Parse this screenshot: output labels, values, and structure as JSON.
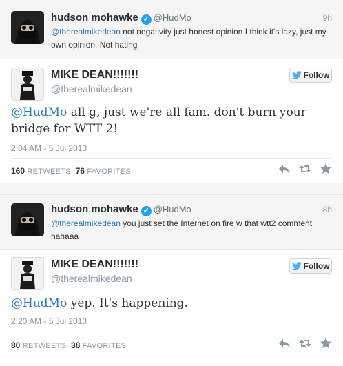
{
  "reply1": {
    "name": "hudson mohawke",
    "handle": "@HudMo",
    "time": "9h",
    "mention": "@therealmikedean",
    "text": " not negativity just honest opinion I think it's lazy, just my own opinion. Not hating"
  },
  "tweet1": {
    "name": "MIKE DEAN!!!!!!!",
    "handle": "@therealmikedean",
    "follow_label": "Follow",
    "mention": "@HudMo",
    "text": " all g,  just we're all fam. don't burn your bridge for WTT 2!",
    "date": "2:04 AM - 5 Jul 2013",
    "retweets_count": "160",
    "retweets_label": "RETWEETS",
    "favorites_count": "76",
    "favorites_label": "FAVORITES"
  },
  "reply2": {
    "name": "hudson mohawke",
    "handle": "@HudMo",
    "time": "8h",
    "mention": "@therealmikedean",
    "text": " you just set the Internet on fire w that wtt2 comment hahaaa"
  },
  "tweet2": {
    "name": "MIKE DEAN!!!!!!!",
    "handle": "@therealmikedean",
    "follow_label": "Follow",
    "mention": "@HudMo",
    "text": "  yep. It's happening.",
    "date": "2:20 AM - 5 Jul 2013",
    "retweets_count": "80",
    "retweets_label": "RETWEETS",
    "favorites_count": "38",
    "favorites_label": "FAVORITES"
  },
  "icons": [
    "verified-badge-icon",
    "twitter-bird-icon",
    "reply-icon",
    "retweet-icon",
    "favorite-icon"
  ],
  "colors": {
    "link": "#2b7bb9",
    "verified": "#1da1f2",
    "muted": "#8899a6"
  }
}
